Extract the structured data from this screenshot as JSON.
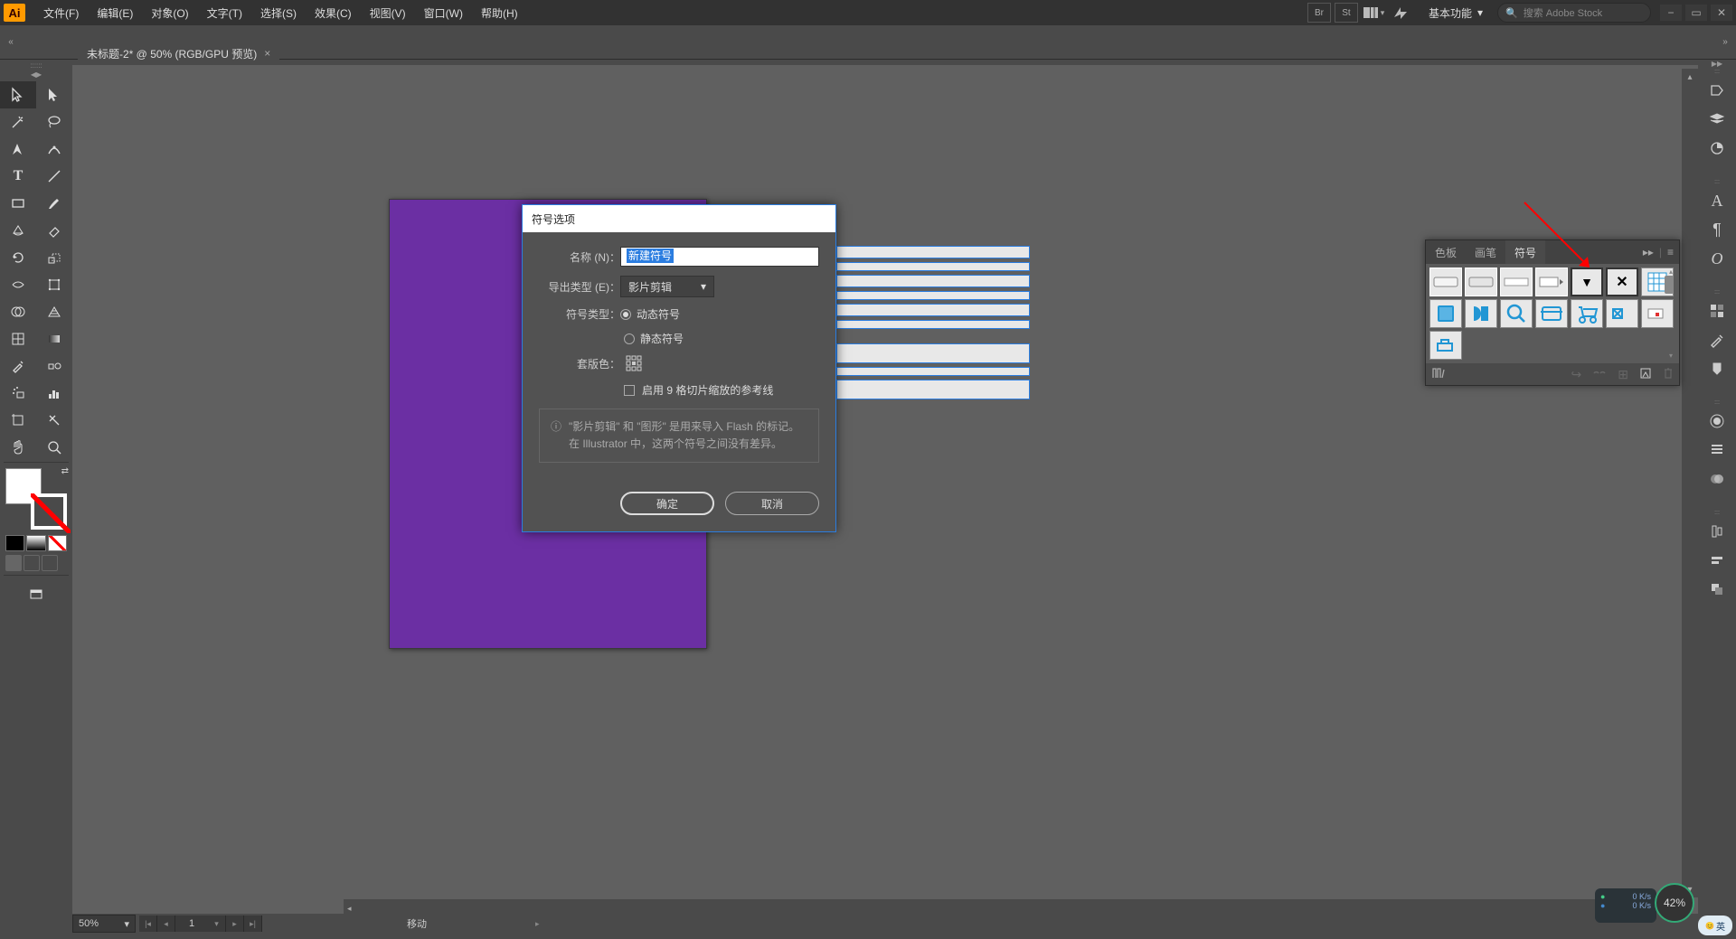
{
  "app": {
    "logo": "Ai"
  },
  "menu": {
    "file": "文件(F)",
    "edit": "编辑(E)",
    "object": "对象(O)",
    "type": "文字(T)",
    "select": "选择(S)",
    "effect": "效果(C)",
    "view": "视图(V)",
    "window": "窗口(W)",
    "help": "帮助(H)"
  },
  "workspace": {
    "label": "基本功能"
  },
  "search": {
    "placeholder": "搜索 Adobe Stock"
  },
  "tab": {
    "title": "未标题-2* @ 50% (RGB/GPU 预览)"
  },
  "symbolsPanel": {
    "tab_swatches": "色板",
    "tab_brushes": "画笔",
    "tab_symbols": "符号"
  },
  "dialog": {
    "title": "符号选项",
    "name_label": "名称 (N)：",
    "name_value": "新建符号",
    "export_label": "导出类型 (E)：",
    "export_value": "影片剪辑",
    "type_label": "符号类型：",
    "type_movie": "动态符号",
    "type_graphic": "静态符号",
    "reg_label": "套版色：",
    "enable9slice": "启用 9 格切片缩放的参考线",
    "info": "\"影片剪辑\" 和 \"图形\" 是用来导入 Flash 的标记。在 Illustrator 中，这两个符号之间没有差异。",
    "ok": "确定",
    "cancel": "取消"
  },
  "status": {
    "zoom": "50%",
    "page": "1",
    "text": "移动"
  },
  "net": {
    "up": "0 K/s",
    "down": "0 K/s",
    "pct": "42%"
  },
  "ime": "英"
}
